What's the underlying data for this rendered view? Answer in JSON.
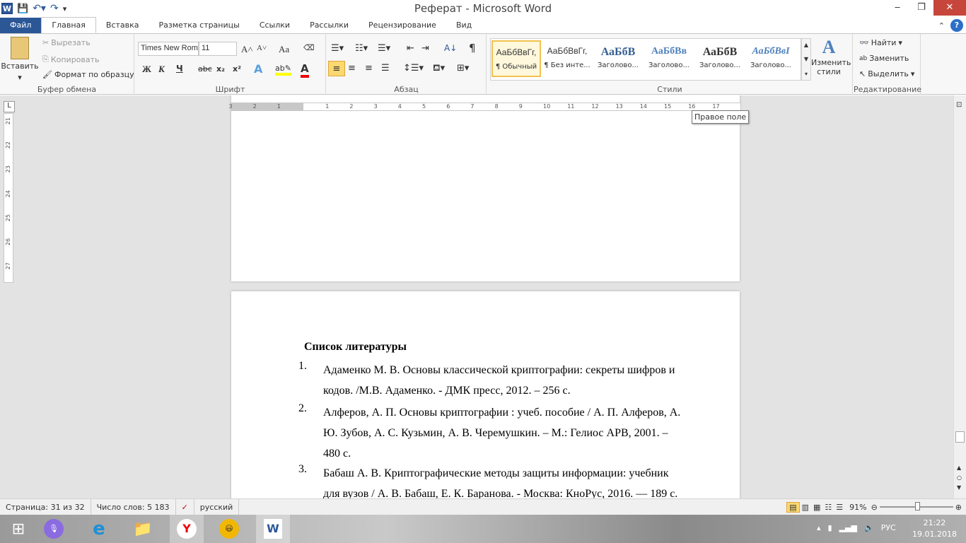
{
  "window": {
    "title": "Реферат - Microsoft Word",
    "minimize": "‒",
    "restore": "❐",
    "close": "✕"
  },
  "tabs": [
    "Файл",
    "Главная",
    "Вставка",
    "Разметка страницы",
    "Ссылки",
    "Рассылки",
    "Рецензирование",
    "Вид"
  ],
  "clipboard": {
    "label": "Буфер обмена",
    "paste": "Вставить",
    "cut": "Вырезать",
    "copy": "Копировать",
    "format_painter": "Формат по образцу"
  },
  "font": {
    "label": "Шрифт",
    "name": "Times New Roman",
    "size": "11",
    "bold": "Ж",
    "italic": "К",
    "underline": "Ч",
    "strike": "abc",
    "sub": "x₂",
    "sup": "x²",
    "grow": "A˄",
    "shrink": "A˅",
    "case": "Aa"
  },
  "paragraph": {
    "label": "Абзац",
    "pilcrow": "¶"
  },
  "styles": {
    "label": "Стили",
    "items": [
      {
        "sample": "АаБбВвГг,",
        "name": "¶ Обычный"
      },
      {
        "sample": "АаБбВвГг,",
        "name": "¶ Без инте..."
      },
      {
        "sample": "АаБбВ",
        "name": "Заголово..."
      },
      {
        "sample": "АаБбВв",
        "name": "Заголово..."
      },
      {
        "sample": "АаБбВ",
        "name": "Заголово..."
      },
      {
        "sample": "АаБбВвІ",
        "name": "Заголово..."
      }
    ],
    "change": "Изменить стили"
  },
  "editing": {
    "label": "Редактирование",
    "find": "Найти",
    "replace": "Заменить",
    "select": "Выделить"
  },
  "ruler": {
    "h_ticks": [
      "3",
      "2",
      "1",
      "1",
      "2",
      "3",
      "4",
      "5",
      "6",
      "7",
      "8",
      "9",
      "10",
      "11",
      "12",
      "13",
      "14",
      "15",
      "16",
      "17"
    ],
    "v_ticks": [
      "21",
      "22",
      "23",
      "24",
      "25",
      "26",
      "27"
    ],
    "tooltip": "Правое поле"
  },
  "document": {
    "heading": "Список литературы",
    "items": [
      {
        "num": "1.",
        "lines": [
          "Адаменко М. В.  Основы классической криптографии: секреты шифров и",
          "кодов. /М.В. Адаменко. -  ДМК пресс, 2012. – 256 с."
        ]
      },
      {
        "num": "2.",
        "lines": [
          "Алферов, А. П. Основы криптографии : учеб. пособие / А. П. Алферов, А.",
          "Ю. Зубов, А. С. Кузьмин, А. В. Черемушкин. – М.: Гелиос АРВ, 2001. –",
          "480 с."
        ]
      },
      {
        "num": "3.",
        "lines": [
          "Бабаш А. В. Криптографические методы защиты информации: учебник",
          "для вузов / А. В. Бабаш, Е. К. Баранова. - Москва: КноРус, 2016. — 189 с."
        ]
      }
    ]
  },
  "status": {
    "page": "Страница: 31 из 32",
    "words": "Число слов: 5 183",
    "language": "русский",
    "zoom": "91%",
    "zoom_percent": 91
  },
  "taskbar": {
    "lang": "РУС",
    "time": "21:22",
    "date": "19.01.2018"
  }
}
